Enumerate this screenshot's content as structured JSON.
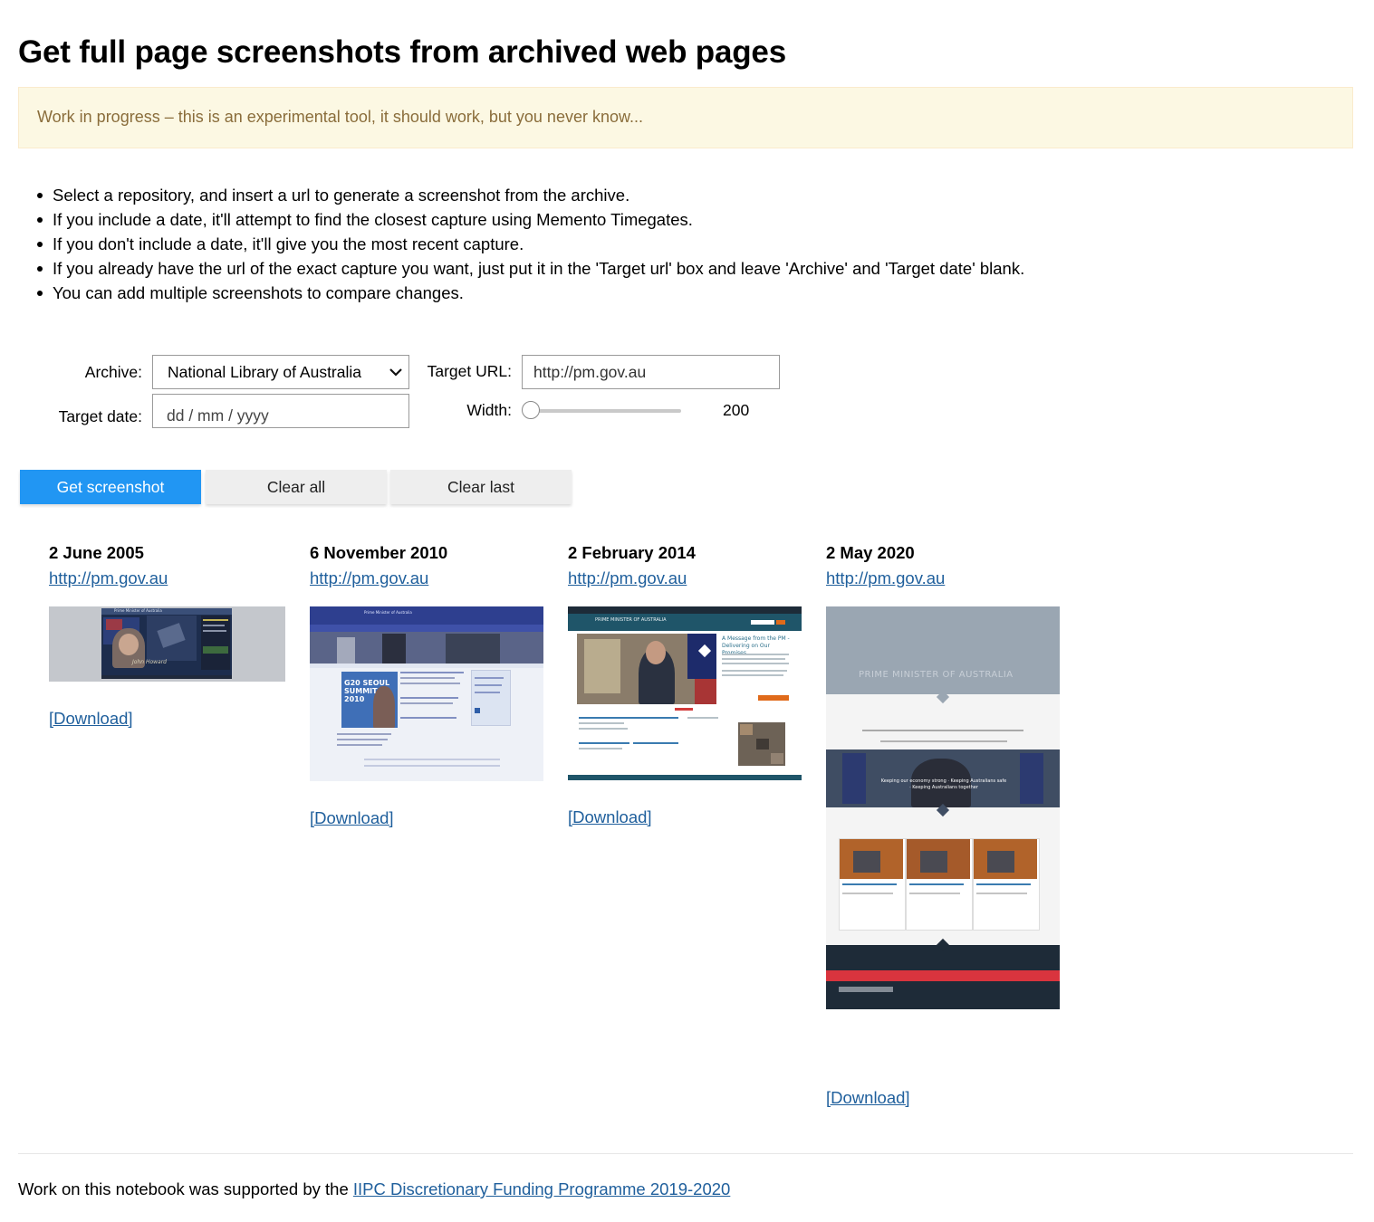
{
  "page": {
    "title": "Get full page screenshots from archived web pages",
    "warning": "Work in progress – this is an experimental tool, it should work, but you never know..."
  },
  "instructions": [
    "Select a repository, and insert a url to generate a screenshot from the archive.",
    "If you include a date, it'll attempt to find the closest capture using Memento Timegates.",
    "If you don't include a date, it'll give you the most recent capture.",
    "If you already have the url of the exact capture you want, just put it in the 'Target url' box and leave 'Archive' and 'Target date' blank.",
    "You can add multiple screenshots to compare changes."
  ],
  "form": {
    "archive_label": "Archive:",
    "archive_value": "National Library of Australia",
    "target_url_label": "Target URL:",
    "target_url_value": "http://pm.gov.au",
    "target_date_label": "Target date:",
    "target_date_placeholder": "dd / mm / yyyy",
    "width_label": "Width:",
    "width_value": "200",
    "width_slider_fraction": 0.0
  },
  "buttons": {
    "get_screenshot": "Get screenshot",
    "clear_all": "Clear all",
    "clear_last": "Clear last"
  },
  "screenshots": [
    {
      "date": "2 June 2005",
      "url": "http://pm.gov.au",
      "download": "[Download]",
      "thumb_text": {
        "header": "Prime Minister of Australia",
        "signature": "John Howard"
      }
    },
    {
      "date": "6 November 2010",
      "url": "http://pm.gov.au",
      "download": "[Download]",
      "thumb_text": {
        "header": "Prime Minister of Australia",
        "badge": "G20 SEOUL SUMMIT 2010"
      }
    },
    {
      "date": "2 February 2014",
      "url": "http://pm.gov.au",
      "download": "[Download]",
      "thumb_text": {
        "header": "PRIME MINISTER OF AUSTRALIA",
        "headline": "A Message from the PM - Delivering on Our Promises"
      }
    },
    {
      "date": "2 May 2020",
      "url": "http://pm.gov.au",
      "download": "[Download]",
      "thumb_text": {
        "header": "PRIME MINISTER OF AUSTRALIA",
        "tagline": "Keeping our economy strong · Keeping Australians safe · Keeping Australians together"
      }
    }
  ],
  "footer": {
    "text": "Work on this notebook was supported by the ",
    "link": "IIPC Discretionary Funding Programme 2019-2020"
  },
  "colors": {
    "primary_button": "#2196f3",
    "warning_background": "#fcf8e3",
    "warning_text": "#8a6d3b",
    "link": "#1f5f9c"
  },
  "icons": {
    "select_arrow": "chevron-down-icon"
  }
}
